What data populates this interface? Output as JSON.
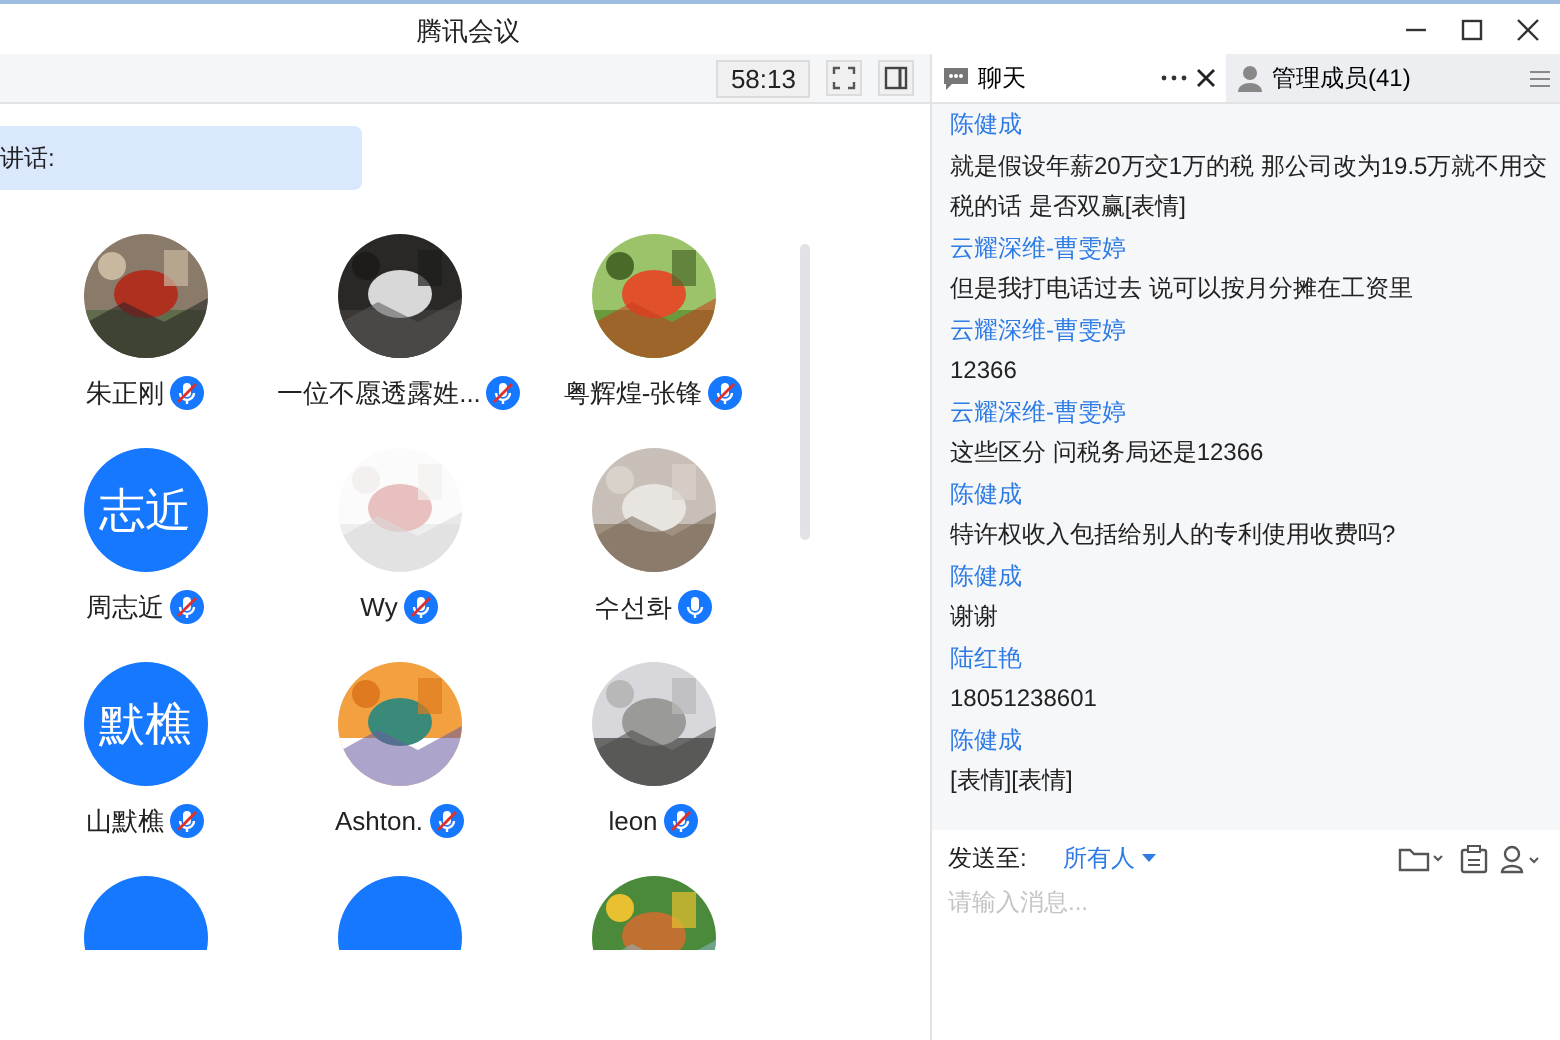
{
  "window": {
    "title": "腾讯会议"
  },
  "toolbar": {
    "timer": "58:13"
  },
  "speaker_banner": {
    "text": "讲话:"
  },
  "participants": [
    {
      "name": "朱正刚",
      "avatar": {
        "kind": "picture"
      },
      "muted": true
    },
    {
      "name": "一位不愿透露姓...",
      "avatar": {
        "kind": "picture"
      },
      "muted": true
    },
    {
      "name": "粤辉煌-张锋",
      "avatar": {
        "kind": "picture"
      },
      "muted": true
    },
    {
      "name": "周志近",
      "avatar": {
        "kind": "initials",
        "text": "志近"
      },
      "muted": true
    },
    {
      "name": "Wy",
      "avatar": {
        "kind": "picture"
      },
      "muted": true
    },
    {
      "name": "수선화",
      "avatar": {
        "kind": "picture"
      },
      "muted": false
    },
    {
      "name": "山默樵",
      "avatar": {
        "kind": "initials",
        "text": "默樵"
      },
      "muted": true
    },
    {
      "name": "Ashton.",
      "avatar": {
        "kind": "picture"
      },
      "muted": true
    },
    {
      "name": "leon",
      "avatar": {
        "kind": "picture"
      },
      "muted": true
    },
    {
      "avatar": {
        "kind": "initials"
      }
    },
    {
      "avatar": {
        "kind": "initials"
      }
    },
    {
      "avatar": {
        "kind": "picture"
      }
    }
  ],
  "chat_tabs": [
    {
      "label": "聊天",
      "selected": true
    },
    {
      "label": "管理成员(41)",
      "selected": false
    }
  ],
  "messages": [
    {
      "sender": "陈健成",
      "text": "就是假设年薪20万交1万的税 那公司改为19.5万就不用交税的话 是否双赢[表情]"
    },
    {
      "sender": "云耀深维-曹雯婷",
      "text": "但是我打电话过去 说可以按月分摊在工资里"
    },
    {
      "sender": "云耀深维-曹雯婷",
      "text": "12366"
    },
    {
      "sender": "云耀深维-曹雯婷",
      "text": "这些区分 问税务局还是12366"
    },
    {
      "sender": "陈健成",
      "text": "特许权收入包括给别人的专利使用收费吗?"
    },
    {
      "sender": "陈健成",
      "text": "谢谢"
    },
    {
      "sender": "陆红艳",
      "text": "18051238601"
    },
    {
      "sender": "陈健成",
      "text": "[表情][表情]"
    }
  ],
  "composer": {
    "send_to_label": "发送至:",
    "recipient": "所有人",
    "placeholder": "请输入消息..."
  }
}
